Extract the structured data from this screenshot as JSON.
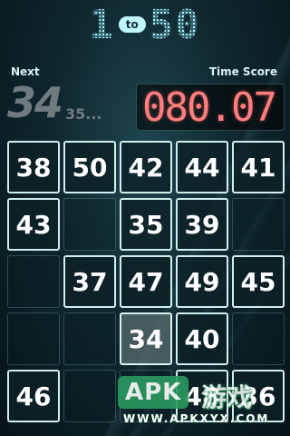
{
  "header": {
    "title_from": "1",
    "title_to_badge": "to",
    "title_until": "50"
  },
  "status": {
    "next_label": "Next",
    "next_value": "34",
    "next_after": "35...",
    "score_label": "Time Score",
    "score_value": "080.07"
  },
  "board": {
    "cells": [
      "38",
      "50",
      "42",
      "44",
      "41",
      "43",
      "",
      "35",
      "39",
      "",
      "",
      "37",
      "47",
      "49",
      "45",
      "",
      "",
      "34",
      "40",
      "",
      "46",
      "",
      "",
      "48",
      "36"
    ],
    "highlight_index": 17
  },
  "watermark": {
    "badge": "APK",
    "chinese": "游戏",
    "url": "WWW.APKXYX.COM"
  },
  "colors": {
    "score_red": "#ff7e7e",
    "title_cyan": "#b9f5ff",
    "watermark_green": "#2a9a60"
  }
}
